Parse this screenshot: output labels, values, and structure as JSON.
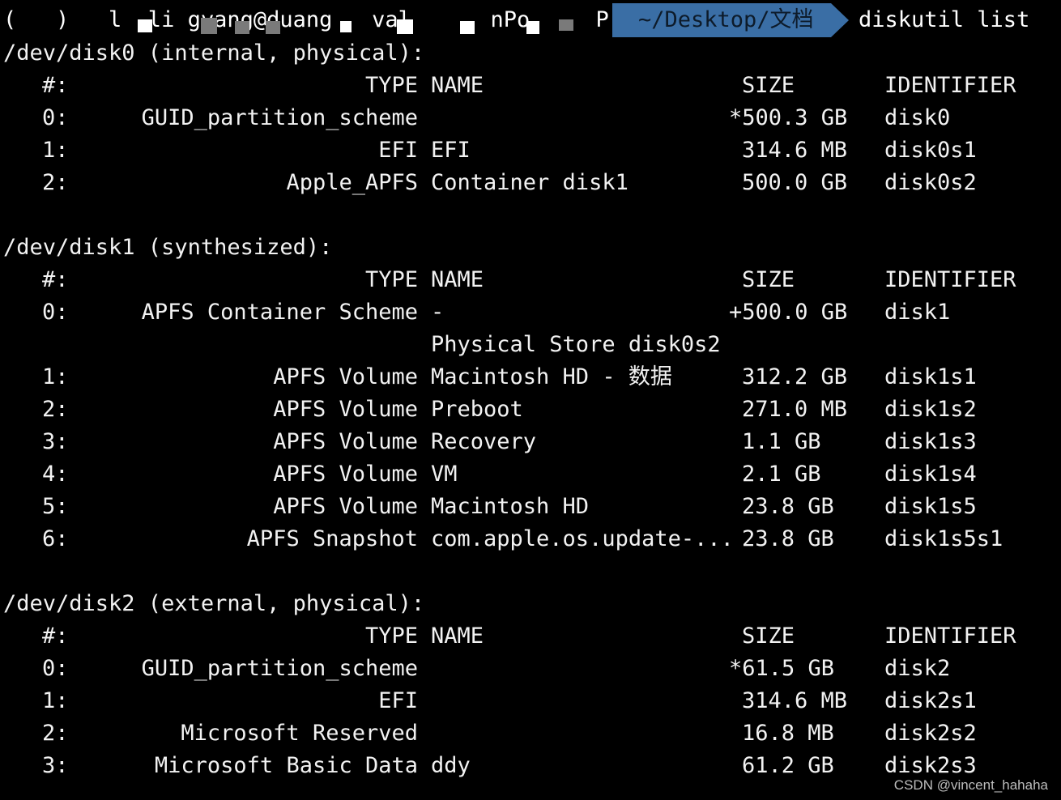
{
  "prompt": {
    "user_host_fragment": "(   )   l  li gyang@duang   val      nPo     Pro",
    "path": "~/Desktop/文档",
    "command": "diskutil list"
  },
  "disks": [
    {
      "header": "/dev/disk0 (internal, physical):",
      "columns": {
        "num": "#:",
        "type": "TYPE",
        "name": "NAME",
        "size": "SIZE",
        "identifier": "IDENTIFIER"
      },
      "rows": [
        {
          "num": "0:",
          "type": "GUID_partition_scheme",
          "name": "",
          "size": "*500.3 GB",
          "identifier": "disk0"
        },
        {
          "num": "1:",
          "type": "EFI",
          "name": "EFI",
          "size": "314.6 MB",
          "identifier": "disk0s1"
        },
        {
          "num": "2:",
          "type": "Apple_APFS",
          "name": "Container disk1",
          "size": "500.0 GB",
          "identifier": "disk0s2"
        }
      ]
    },
    {
      "header": "/dev/disk1 (synthesized):",
      "columns": {
        "num": "#:",
        "type": "TYPE",
        "name": "NAME",
        "size": "SIZE",
        "identifier": "IDENTIFIER"
      },
      "rows": [
        {
          "num": "0:",
          "type": "APFS Container Scheme",
          "name": "-",
          "size": "+500.0 GB",
          "identifier": "disk1"
        },
        {
          "num": "",
          "type": "",
          "name": "Physical Store disk0s2",
          "size": "",
          "identifier": ""
        },
        {
          "num": "1:",
          "type": "APFS Volume",
          "name": "Macintosh HD - 数据",
          "size": "312.2 GB",
          "identifier": "disk1s1"
        },
        {
          "num": "2:",
          "type": "APFS Volume",
          "name": "Preboot",
          "size": "271.0 MB",
          "identifier": "disk1s2"
        },
        {
          "num": "3:",
          "type": "APFS Volume",
          "name": "Recovery",
          "size": "1.1 GB",
          "identifier": "disk1s3"
        },
        {
          "num": "4:",
          "type": "APFS Volume",
          "name": "VM",
          "size": "2.1 GB",
          "identifier": "disk1s4"
        },
        {
          "num": "5:",
          "type": "APFS Volume",
          "name": "Macintosh HD",
          "size": "23.8 GB",
          "identifier": "disk1s5"
        },
        {
          "num": "6:",
          "type": "APFS Snapshot",
          "name": "com.apple.os.update-...",
          "size": "23.8 GB",
          "identifier": "disk1s5s1"
        }
      ]
    },
    {
      "header": "/dev/disk2 (external, physical):",
      "columns": {
        "num": "#:",
        "type": "TYPE",
        "name": "NAME",
        "size": "SIZE",
        "identifier": "IDENTIFIER"
      },
      "rows": [
        {
          "num": "0:",
          "type": "GUID_partition_scheme",
          "name": "",
          "size": "*61.5 GB",
          "identifier": "disk2"
        },
        {
          "num": "1:",
          "type": "EFI",
          "name": "",
          "size": "314.6 MB",
          "identifier": "disk2s1"
        },
        {
          "num": "2:",
          "type": "Microsoft Reserved",
          "name": "",
          "size": "16.8 MB",
          "identifier": "disk2s2"
        },
        {
          "num": "3:",
          "type": "Microsoft Basic Data",
          "name": "ddy",
          "size": "61.2 GB",
          "identifier": "disk2s3"
        }
      ]
    }
  ],
  "watermark": "CSDN @vincent_hahaha",
  "colors": {
    "background": "#000000",
    "foreground": "#f2f2f2",
    "path_segment": "#3a6ea5"
  }
}
